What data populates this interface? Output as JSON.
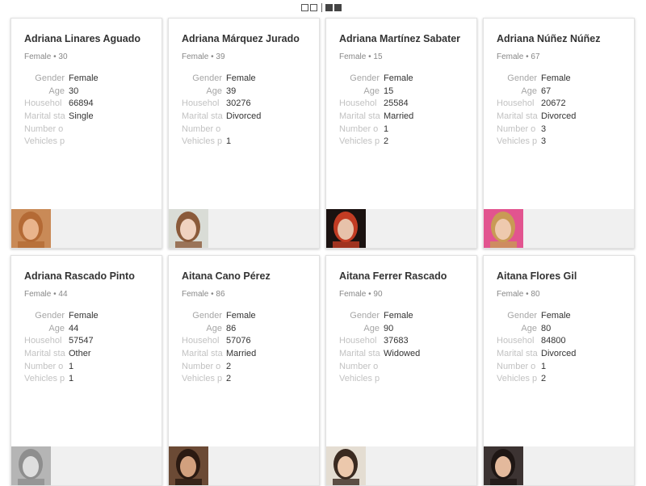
{
  "toolbar": {
    "view_modes": [
      "grid-outline-icon",
      "list-filled-icon"
    ]
  },
  "cards": [
    {
      "name": "Adriana Linares Aguado",
      "summary": "Female • 30",
      "labels": [
        "Gender",
        "Age",
        "Househol",
        "Marital sta",
        "Number o",
        "Vehicles p"
      ],
      "values": [
        "Female",
        "30",
        "66894",
        "Single",
        "",
        ""
      ],
      "photo": {
        "bg": "#c98a57",
        "face": "#e9b48c",
        "hair": "#b46a35"
      }
    },
    {
      "name": "Adriana Márquez Jurado",
      "summary": "Female • 39",
      "labels": [
        "Gender",
        "Age",
        "Househol",
        "Marital sta",
        "Number o",
        "Vehicles p"
      ],
      "values": [
        "Female",
        "39",
        "30276",
        "Divorced",
        "",
        "1"
      ],
      "photo": {
        "bg": "#d9dcd6",
        "face": "#f0d2c0",
        "hair": "#8a5a3a"
      }
    },
    {
      "name": "Adriana Martínez Sabater",
      "summary": "Female • 15",
      "labels": [
        "Gender",
        "Age",
        "Househol",
        "Marital sta",
        "Number o",
        "Vehicles p"
      ],
      "values": [
        "Female",
        "15",
        "25584",
        "Married",
        "1",
        "2"
      ],
      "photo": {
        "bg": "#1b1210",
        "face": "#e7c2aa",
        "hair": "#c23c23"
      }
    },
    {
      "name": "Adriana Núñez Núñez",
      "summary": "Female • 67",
      "labels": [
        "Gender",
        "Age",
        "Househol",
        "Marital sta",
        "Number o",
        "Vehicles p"
      ],
      "values": [
        "Female",
        "67",
        "20672",
        "Divorced",
        "3",
        "3"
      ],
      "photo": {
        "bg": "#e2548f",
        "face": "#eec9ae",
        "hair": "#c99a55"
      }
    },
    {
      "name": "Adriana Rascado Pinto",
      "summary": "Female • 44",
      "labels": [
        "Gender",
        "Age",
        "Househol",
        "Marital sta",
        "Number o",
        "Vehicles p"
      ],
      "values": [
        "Female",
        "44",
        "57547",
        "Other",
        "1",
        "1"
      ],
      "photo": {
        "bg": "#b5b5b5",
        "face": "#dedede",
        "hair": "#8e8e8e"
      }
    },
    {
      "name": "Aitana Cano Pérez",
      "summary": "Female • 86",
      "labels": [
        "Gender",
        "Age",
        "Househol",
        "Marital sta",
        "Number o",
        "Vehicles p"
      ],
      "values": [
        "Female",
        "86",
        "57076",
        "Married",
        "2",
        "2"
      ],
      "photo": {
        "bg": "#6b4a35",
        "face": "#d2a07e",
        "hair": "#2b1a12"
      }
    },
    {
      "name": "Aitana Ferrer Rascado",
      "summary": "Female • 90",
      "labels": [
        "Gender",
        "Age",
        "Househol",
        "Marital sta",
        "Number o",
        "Vehicles p"
      ],
      "values": [
        "Female",
        "90",
        "37683",
        "Widowed",
        "",
        ""
      ],
      "photo": {
        "bg": "#e4ddd2",
        "face": "#ecc8ac",
        "hair": "#3a2a20"
      }
    },
    {
      "name": "Aitana Flores Gil",
      "summary": "Female • 80",
      "labels": [
        "Gender",
        "Age",
        "Househol",
        "Marital sta",
        "Number o",
        "Vehicles p"
      ],
      "values": [
        "Female",
        "80",
        "84800",
        "Divorced",
        "1",
        "2"
      ],
      "photo": {
        "bg": "#3c3332",
        "face": "#e3b99c",
        "hair": "#1e1614"
      }
    }
  ]
}
